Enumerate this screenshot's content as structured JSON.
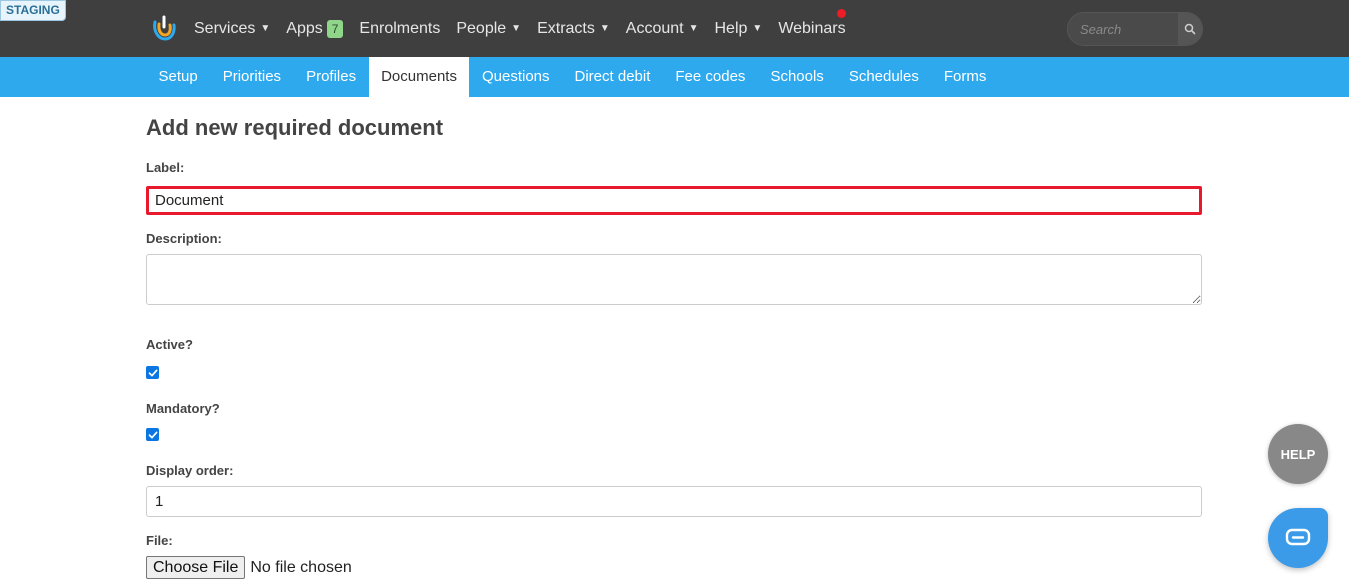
{
  "staging_label": "STAGING",
  "topnav": {
    "items": [
      {
        "label": "Services",
        "dropdown": true
      },
      {
        "label": "Apps",
        "badge": "7"
      },
      {
        "label": "Enrolments",
        "dropdown": false
      },
      {
        "label": "People",
        "dropdown": true
      },
      {
        "label": "Extracts",
        "dropdown": true
      },
      {
        "label": "Account",
        "dropdown": true
      },
      {
        "label": "Help",
        "dropdown": true
      },
      {
        "label": "Webinars",
        "dropdown": false
      }
    ],
    "search_placeholder": "Search",
    "notification_color": "#ee1c25"
  },
  "subnav": {
    "items": [
      "Setup",
      "Priorities",
      "Profiles",
      "Documents",
      "Questions",
      "Direct debit",
      "Fee codes",
      "Schools",
      "Schedules",
      "Forms"
    ],
    "active": "Documents",
    "color": "#2ea9ee"
  },
  "form": {
    "title": "Add new required document",
    "label_label": "Label:",
    "label_value": "Document",
    "description_label": "Description:",
    "description_value": "",
    "active_label": "Active?",
    "active_checked": true,
    "mandatory_label": "Mandatory?",
    "mandatory_checked": true,
    "display_order_label": "Display order:",
    "display_order_value": "1",
    "file_label": "File:",
    "choose_file_label": "Choose File",
    "file_status": "No file chosen"
  },
  "help_button_label": "HELP"
}
